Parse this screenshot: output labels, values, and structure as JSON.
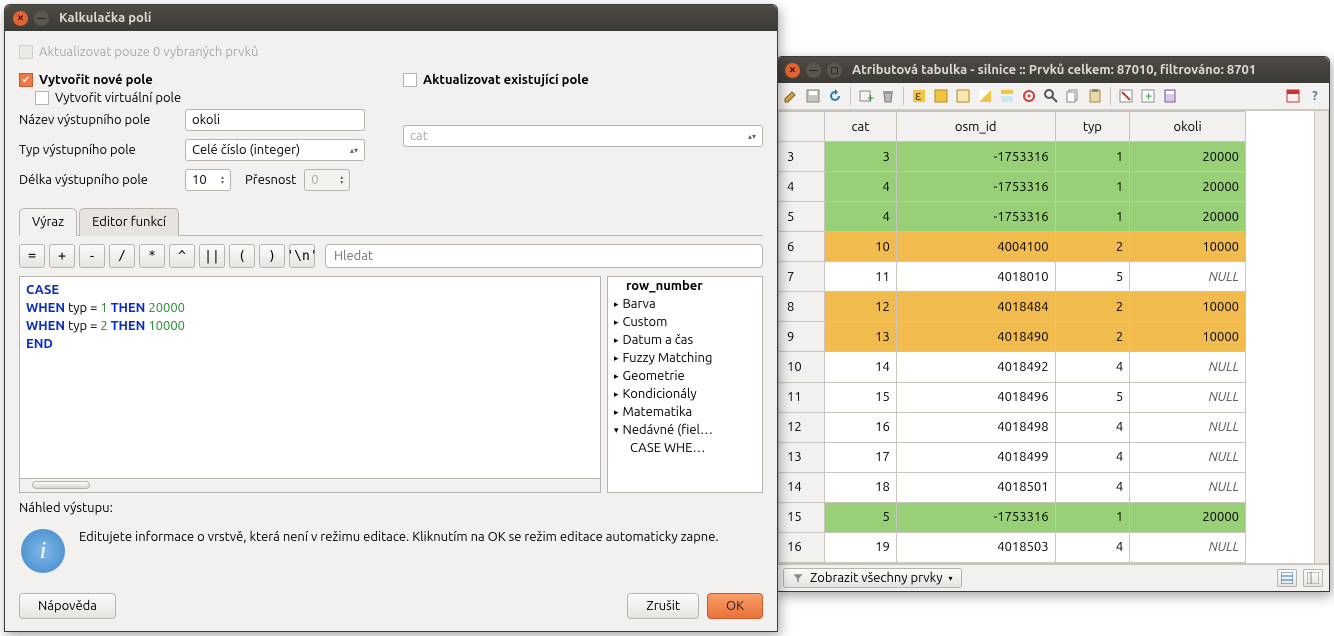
{
  "calc": {
    "title": "Kalkulačka polí",
    "update_selected_label": "Aktualizovat pouze 0 vybraných prvků",
    "create_new_label": "Vytvořit nové pole",
    "update_existing_label": "Aktualizovat existující pole",
    "create_virtual_label": "Vytvořit virtuální pole",
    "output_name_label": "Název výstupního pole",
    "output_name_value": "okoli",
    "output_type_label": "Typ výstupního pole",
    "output_type_value": "Celé číslo (integer)",
    "output_length_label": "Délka výstupního pole",
    "output_length_value": "10",
    "precision_label": "Přesnost",
    "precision_value": "0",
    "existing_field_value": "cat",
    "tabs": {
      "expression": "Výraz",
      "func_editor": "Editor funkcí"
    },
    "ops": [
      "=",
      "+",
      "-",
      "/",
      "*",
      "^",
      "||",
      "(",
      ")",
      "'\\n'"
    ],
    "search_placeholder": "Hledat",
    "expression_tokens": [
      [
        {
          "t": "CASE",
          "c": "kw"
        }
      ],
      [
        {
          "t": "WHEN",
          "c": "kw"
        },
        {
          "t": " typ = "
        },
        {
          "t": "1",
          "c": "num"
        },
        {
          "t": " "
        },
        {
          "t": "THEN",
          "c": "kw"
        },
        {
          "t": " "
        },
        {
          "t": "20000",
          "c": "num"
        }
      ],
      [
        {
          "t": "WHEN",
          "c": "kw"
        },
        {
          "t": " typ = "
        },
        {
          "t": "2",
          "c": "num"
        },
        {
          "t": " "
        },
        {
          "t": "THEN",
          "c": "kw"
        },
        {
          "t": " "
        },
        {
          "t": "10000",
          "c": "num"
        }
      ],
      [
        {
          "t": "END",
          "c": "kw"
        }
      ]
    ],
    "func_tree": [
      {
        "label": "row_number",
        "bold": true,
        "indent": 1
      },
      {
        "label": "Barva",
        "expand": "▸"
      },
      {
        "label": "Custom",
        "expand": "▸"
      },
      {
        "label": "Datum a čas",
        "expand": "▸"
      },
      {
        "label": "Fuzzy Matching",
        "expand": "▸"
      },
      {
        "label": "Geometrie",
        "expand": "▸"
      },
      {
        "label": "Kondicionály",
        "expand": "▸"
      },
      {
        "label": "Matematika",
        "expand": "▸"
      },
      {
        "label": "Nedávné (fiel…",
        "expand": "▾"
      },
      {
        "label": "CASE WHE…",
        "sub": true
      }
    ],
    "preview_label": "Náhled výstupu:",
    "info_text": "Editujete informace o vrstvě, která není v režimu editace. Kliknutím na OK se režim editace automaticky zapne.",
    "buttons": {
      "help": "Nápověda",
      "cancel": "Zrušit",
      "ok": "OK"
    }
  },
  "attr": {
    "title": "Atributová tabulka  - silnice :: Prvků celkem: 87010, filtrováno: 8701",
    "columns": [
      "cat",
      "osm_id",
      "typ",
      "okoli"
    ],
    "rows": [
      {
        "n": "3",
        "cls": "green",
        "cells": [
          "3",
          "-1753316",
          "1",
          "20000"
        ]
      },
      {
        "n": "4",
        "cls": "green",
        "cells": [
          "4",
          "-1753316",
          "1",
          "20000"
        ]
      },
      {
        "n": "5",
        "cls": "green",
        "cells": [
          "4",
          "-1753316",
          "1",
          "20000"
        ]
      },
      {
        "n": "6",
        "cls": "orange",
        "cells": [
          "10",
          "4004100",
          "2",
          "10000"
        ]
      },
      {
        "n": "7",
        "cls": "",
        "cells": [
          "11",
          "4018010",
          "5",
          "NULL"
        ]
      },
      {
        "n": "8",
        "cls": "orange",
        "cells": [
          "12",
          "4018484",
          "2",
          "10000"
        ]
      },
      {
        "n": "9",
        "cls": "orange",
        "cells": [
          "13",
          "4018490",
          "2",
          "10000"
        ]
      },
      {
        "n": "10",
        "cls": "",
        "cells": [
          "14",
          "4018492",
          "4",
          "NULL"
        ]
      },
      {
        "n": "11",
        "cls": "",
        "cells": [
          "15",
          "4018496",
          "5",
          "NULL"
        ]
      },
      {
        "n": "12",
        "cls": "",
        "cells": [
          "16",
          "4018498",
          "4",
          "NULL"
        ]
      },
      {
        "n": "13",
        "cls": "",
        "cells": [
          "17",
          "4018499",
          "4",
          "NULL"
        ]
      },
      {
        "n": "14",
        "cls": "",
        "cells": [
          "18",
          "4018501",
          "4",
          "NULL"
        ]
      },
      {
        "n": "15",
        "cls": "green",
        "cells": [
          "5",
          "-1753316",
          "1",
          "20000"
        ]
      },
      {
        "n": "16",
        "cls": "",
        "cells": [
          "19",
          "4018503",
          "4",
          "NULL"
        ]
      }
    ],
    "status_filter": "Zobrazit všechny prvky",
    "help_glyph": "?"
  }
}
